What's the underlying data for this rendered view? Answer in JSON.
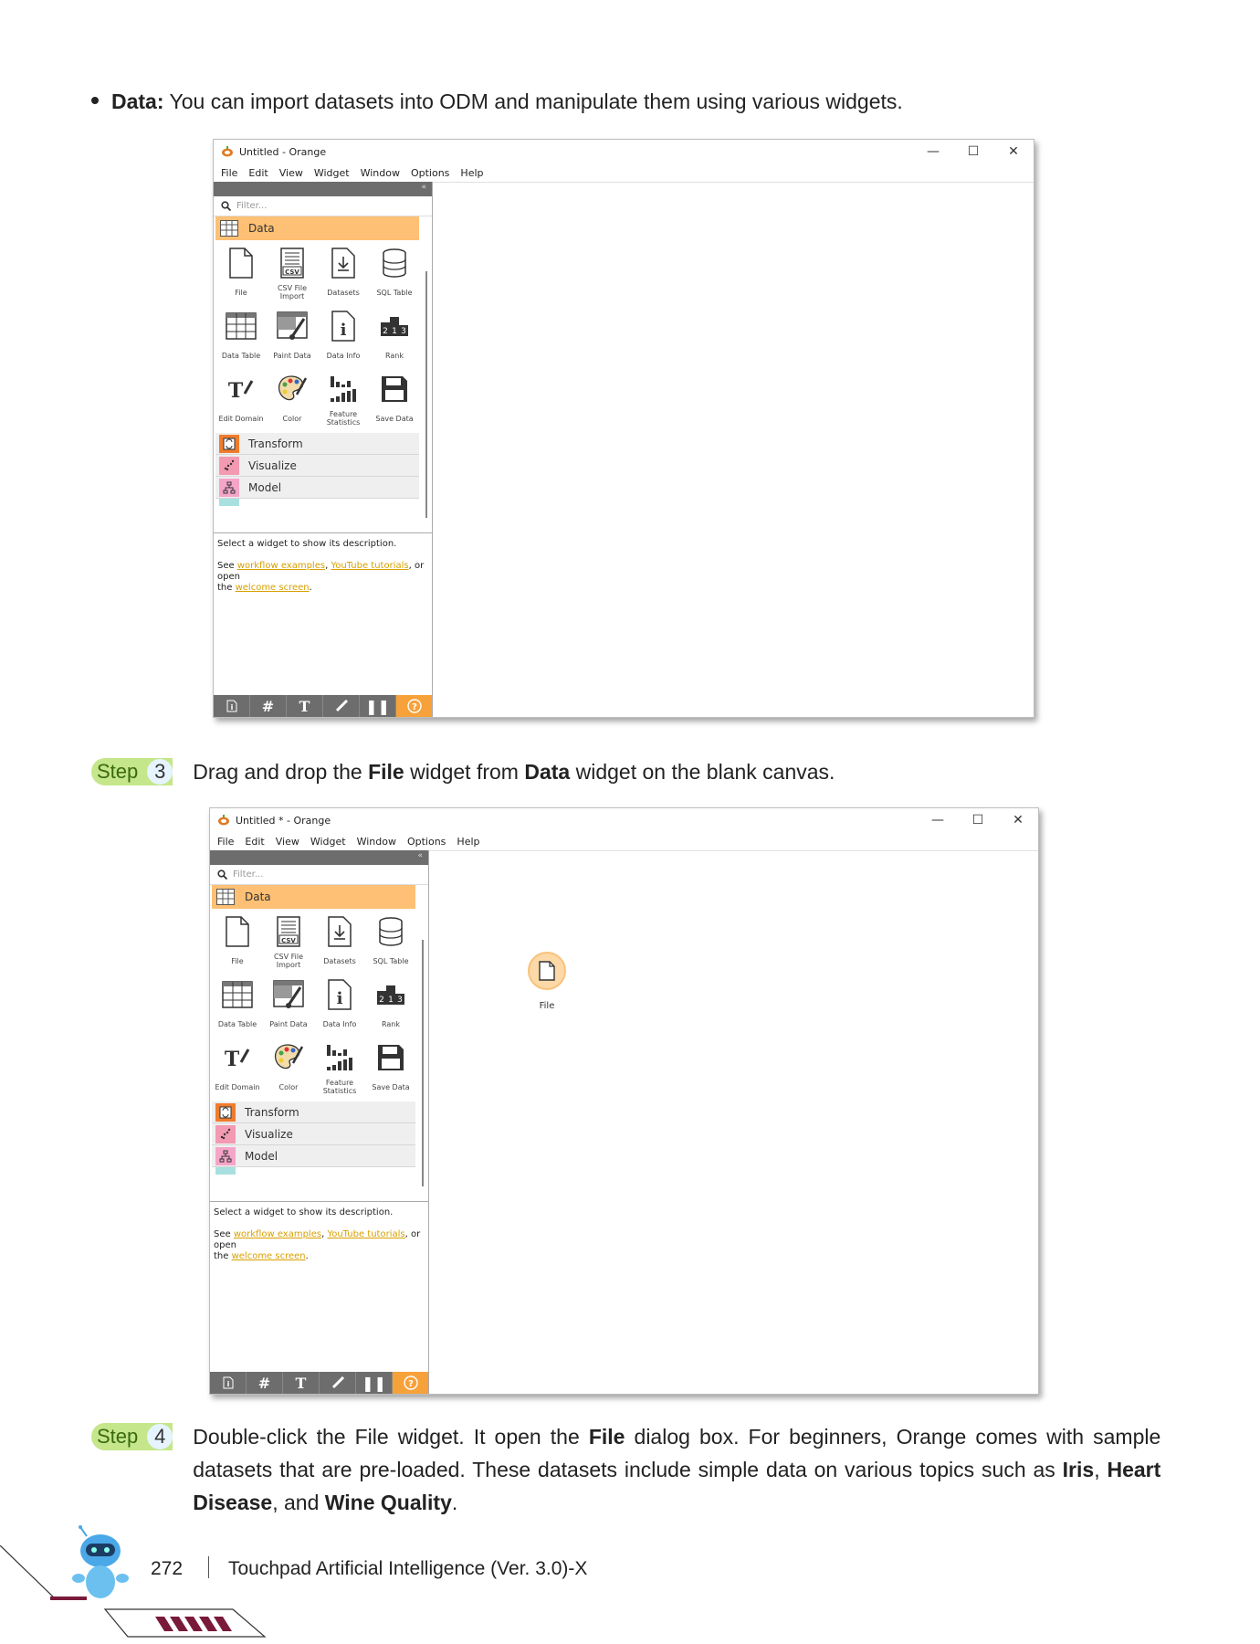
{
  "bullet": {
    "label": "Data:",
    "text": " You can import datasets into ODM and manipulate them using various widgets."
  },
  "step3": {
    "word": "Step",
    "num": "3",
    "pre": "Drag and drop the ",
    "b1": "File",
    "mid": " widget from ",
    "b2": "Data",
    "post": " widget on the blank canvas."
  },
  "step4": {
    "word": "Step",
    "num": "4",
    "pre": "Double-click the File widget. It open the ",
    "b1": "File",
    "mid1": " dialog box. For beginners, Orange comes with sample datasets that are pre-loaded. These datasets include simple data on various topics such as ",
    "b2": "Iris",
    "mid2": ", ",
    "b3": "Heart Disease",
    "mid3": ", and ",
    "b4": "Wine Quality",
    "post": "."
  },
  "window1": {
    "title": "Untitled  - Orange"
  },
  "window2": {
    "title": "Untitled * - Orange",
    "node_label": "File"
  },
  "menu": [
    "File",
    "Edit",
    "View",
    "Widget",
    "Window",
    "Options",
    "Help"
  ],
  "dock": {
    "filter_placeholder": "Filter...",
    "collapse": "«",
    "category_data": "Data",
    "widgets": [
      {
        "label": "File",
        "icon": "file-icon"
      },
      {
        "label": "CSV File Import",
        "icon": "csv-icon"
      },
      {
        "label": "Datasets",
        "icon": "datasets-icon"
      },
      {
        "label": "SQL Table",
        "icon": "database-icon"
      },
      {
        "label": "Data Table",
        "icon": "table-icon"
      },
      {
        "label": "Paint Data",
        "icon": "paint-icon"
      },
      {
        "label": "Data Info",
        "icon": "info-icon"
      },
      {
        "label": "Rank",
        "icon": "rank-icon"
      },
      {
        "label": "Edit Domain",
        "icon": "edit-domain-icon"
      },
      {
        "label": "Color",
        "icon": "palette-icon"
      },
      {
        "label": "Feature Statistics",
        "icon": "statistics-icon"
      },
      {
        "label": "Save Data",
        "icon": "save-icon"
      }
    ],
    "categories": [
      "Transform",
      "Visualize",
      "Model"
    ],
    "desc_line1": "Select a widget to show its description.",
    "desc_see": "See ",
    "desc_link1": "workflow examples",
    "desc_comma": ", ",
    "desc_link2": "YouTube tutorials",
    "desc_or": ", or open",
    "desc_the": "the ",
    "desc_link3": "welcome screen",
    "desc_dot": "."
  },
  "window_controls": {
    "minimize": "—",
    "maximize": "☐",
    "close": "✕"
  },
  "toolbar_icons": [
    "info-icon",
    "grid-icon",
    "text-icon",
    "pen-icon",
    "pause-icon",
    "help-icon"
  ],
  "footer": {
    "page": "272",
    "book": "Touchpad Artificial Intelligence (Ver. 3.0)-X"
  },
  "colors": {
    "accent": "#fdc074",
    "step_badge": "#c5e68a",
    "toolbar": "#6d6d6d",
    "help": "#f7a13a",
    "link": "#d8a000"
  }
}
